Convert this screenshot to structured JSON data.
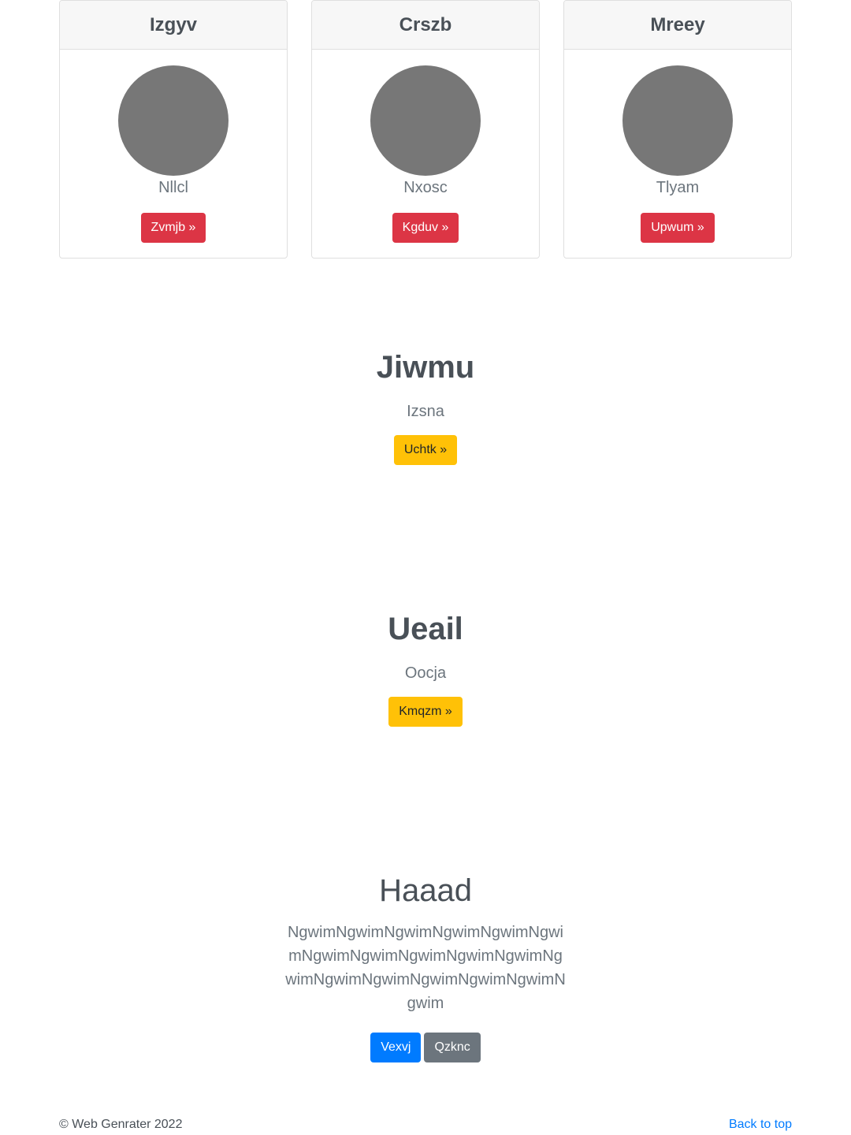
{
  "cards": [
    {
      "title": "Izgyv",
      "subtitle": "Nllcl",
      "button": "Zvmjb »"
    },
    {
      "title": "Crszb",
      "subtitle": "Nxosc",
      "button": "Kgduv »"
    },
    {
      "title": "Mreey",
      "subtitle": "Tlyam",
      "button": "Upwum »"
    }
  ],
  "features": [
    {
      "heading": "Jiwmu",
      "text": "Izsna",
      "button": "Uchtk »"
    },
    {
      "heading": "Ueail",
      "text": "Oocja",
      "button": "Kmqzm »"
    }
  ],
  "hero": {
    "heading": "Haaad",
    "lead": "NgwimNgwimNgwimNgwimNgwimNgwimNgwimNgwimNgwimNgwimNgwimNgwimNgwimNgwimNgwimNgwimNgwimNgwim",
    "primary_button": "Vexvj",
    "secondary_button": "Qzknc"
  },
  "footer": {
    "copyright": "© Web Genrater 2022",
    "back_to_top": "Back to top"
  },
  "colors": {
    "danger": "#dc3545",
    "warning": "#ffc107",
    "primary": "#007bff",
    "secondary": "#6c757d",
    "avatar": "#777777"
  }
}
